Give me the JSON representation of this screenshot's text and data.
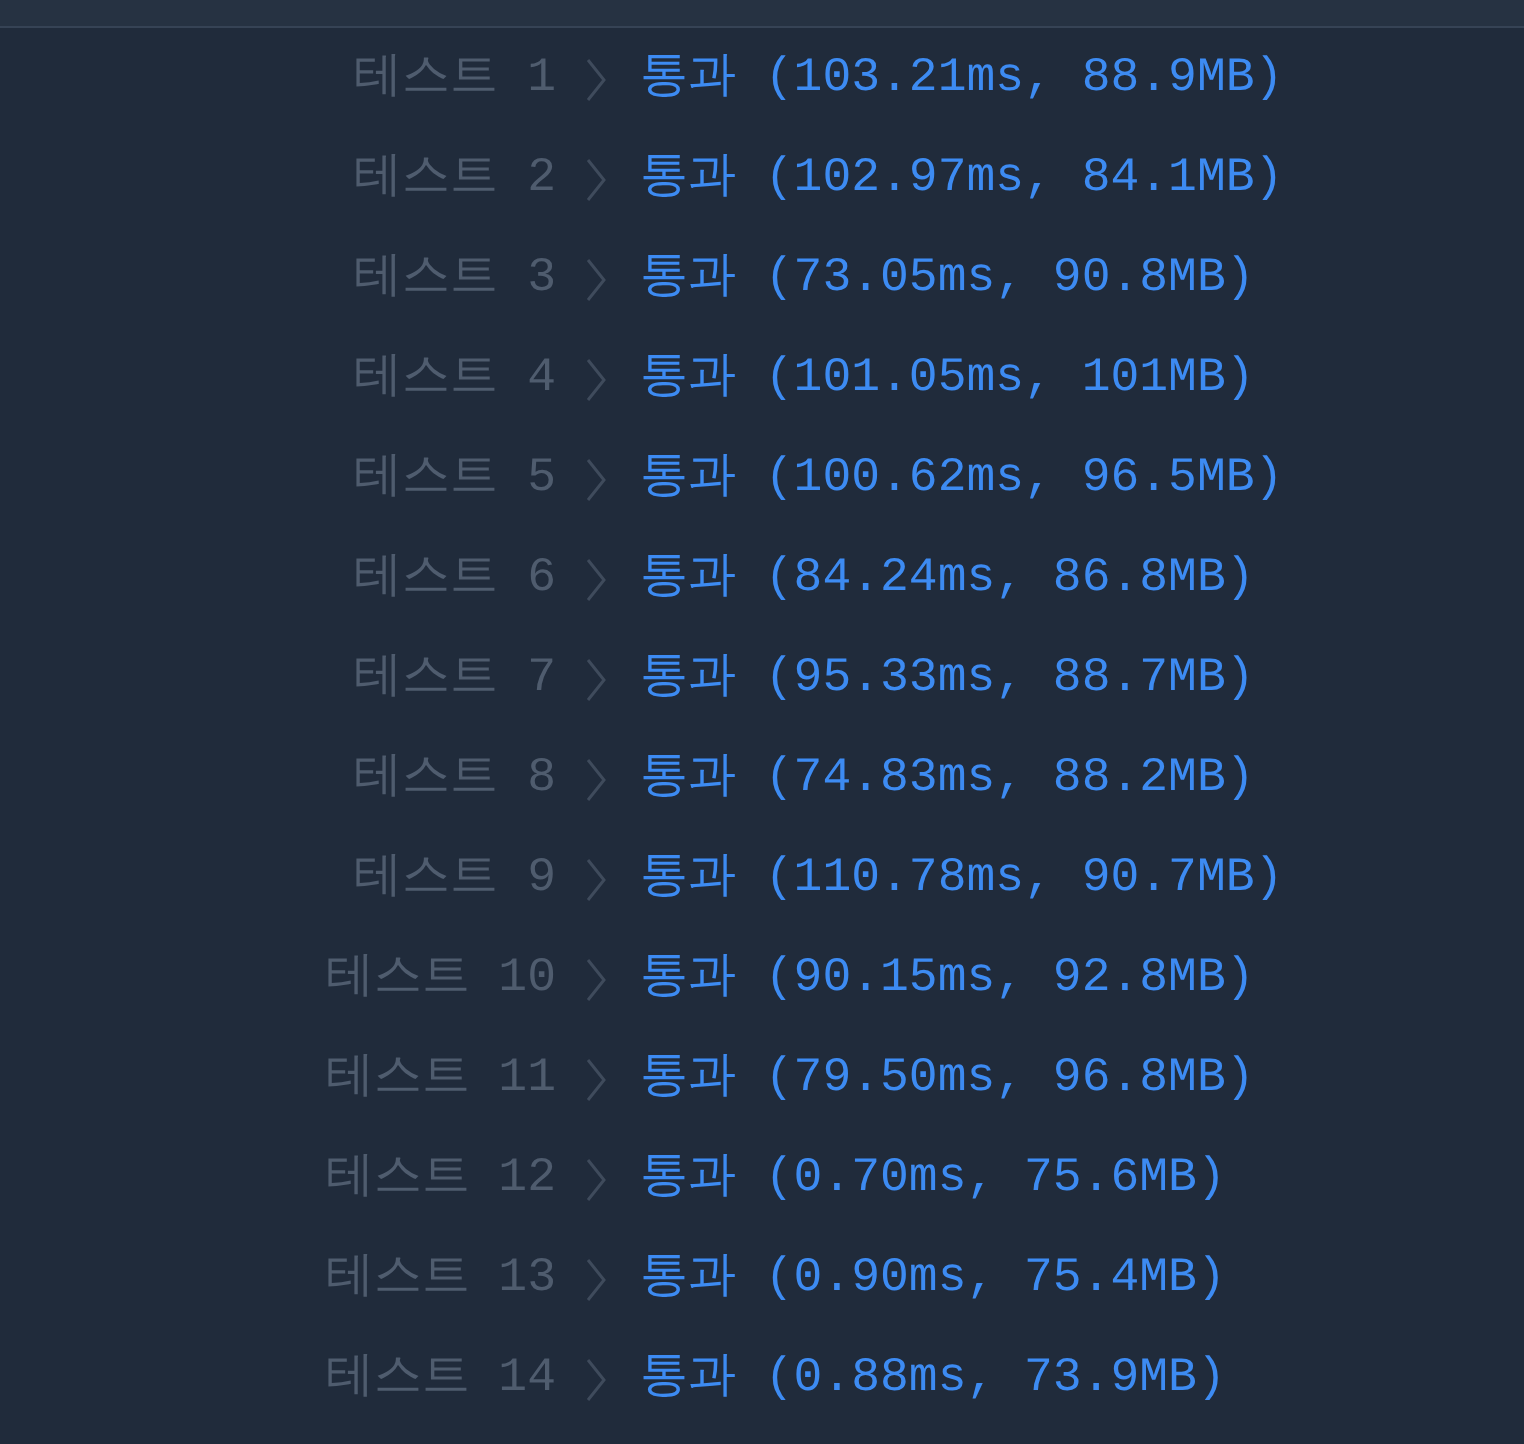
{
  "results": [
    {
      "label": "테스트 1",
      "result": "통과 (103.21ms, 88.9MB)"
    },
    {
      "label": "테스트 2",
      "result": "통과 (102.97ms, 84.1MB)"
    },
    {
      "label": "테스트 3",
      "result": "통과 (73.05ms, 90.8MB)"
    },
    {
      "label": "테스트 4",
      "result": "통과 (101.05ms, 101MB)"
    },
    {
      "label": "테스트 5",
      "result": "통과 (100.62ms, 96.5MB)"
    },
    {
      "label": "테스트 6",
      "result": "통과 (84.24ms, 86.8MB)"
    },
    {
      "label": "테스트 7",
      "result": "통과 (95.33ms, 88.7MB)"
    },
    {
      "label": "테스트 8",
      "result": "통과 (74.83ms, 88.2MB)"
    },
    {
      "label": "테스트 9",
      "result": "통과 (110.78ms, 90.7MB)"
    },
    {
      "label": "테스트 10",
      "result": "통과 (90.15ms, 92.8MB)"
    },
    {
      "label": "테스트 11",
      "result": "통과 (79.50ms, 96.8MB)"
    },
    {
      "label": "테스트 12",
      "result": "통과 (0.70ms, 75.6MB)"
    },
    {
      "label": "테스트 13",
      "result": "통과 (0.90ms, 75.4MB)"
    },
    {
      "label": "테스트 14",
      "result": "통과 (0.88ms, 73.9MB)"
    }
  ]
}
